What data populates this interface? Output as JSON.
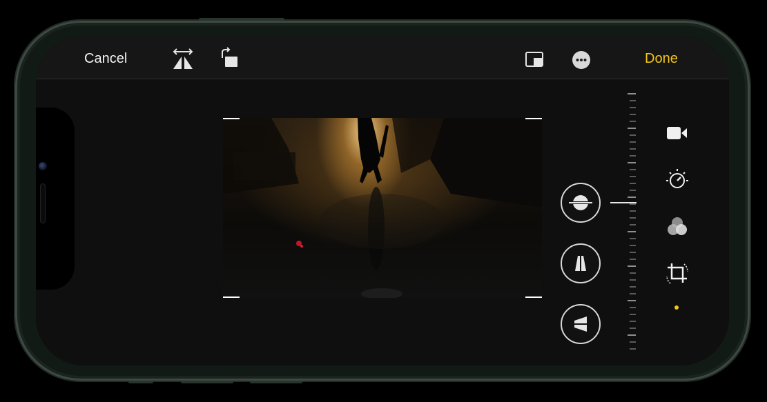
{
  "toolbar": {
    "cancel_label": "Cancel",
    "done_label": "Done",
    "done_color": "#f5c518",
    "icons": [
      "flip-horizontal-icon",
      "rotate-icon",
      "aspect-ratio-icon",
      "more-options-icon"
    ]
  },
  "photo": {
    "description_icon": "video-frame"
  },
  "adjust_tools": {
    "items": [
      "straighten-icon",
      "vertical-perspective-icon",
      "horizontal-perspective-icon"
    ],
    "selected": "straighten-icon"
  },
  "edit_modes": {
    "items": [
      "video-icon",
      "adjust-icon",
      "filters-icon",
      "crop-icon"
    ],
    "active": "crop-icon",
    "active_color": "#f5c518"
  }
}
